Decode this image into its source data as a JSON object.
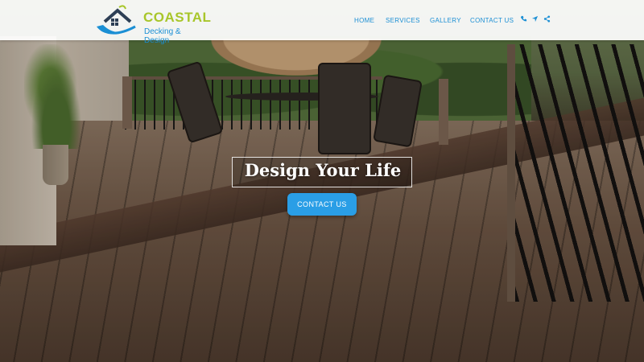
{
  "brand": {
    "name": "COASTAL",
    "tagline": "Decking & Design",
    "logo_icon": "house-wave-logo",
    "colors": {
      "primary_blue": "#1b8fd4",
      "lime": "#a8c62a",
      "cta": "#2a9ee6"
    }
  },
  "nav": {
    "items": [
      {
        "label": "HOME"
      },
      {
        "label": "SERVICES"
      },
      {
        "label": "GALLERY"
      },
      {
        "label": "CONTACT US"
      }
    ],
    "icons": [
      "phone-icon",
      "location-arrow-icon",
      "share-icon"
    ]
  },
  "hero": {
    "headline": "Design Your Life",
    "cta_label": "CONTACT US",
    "background": "wooden deck with patio table, chairs and umbrella"
  }
}
